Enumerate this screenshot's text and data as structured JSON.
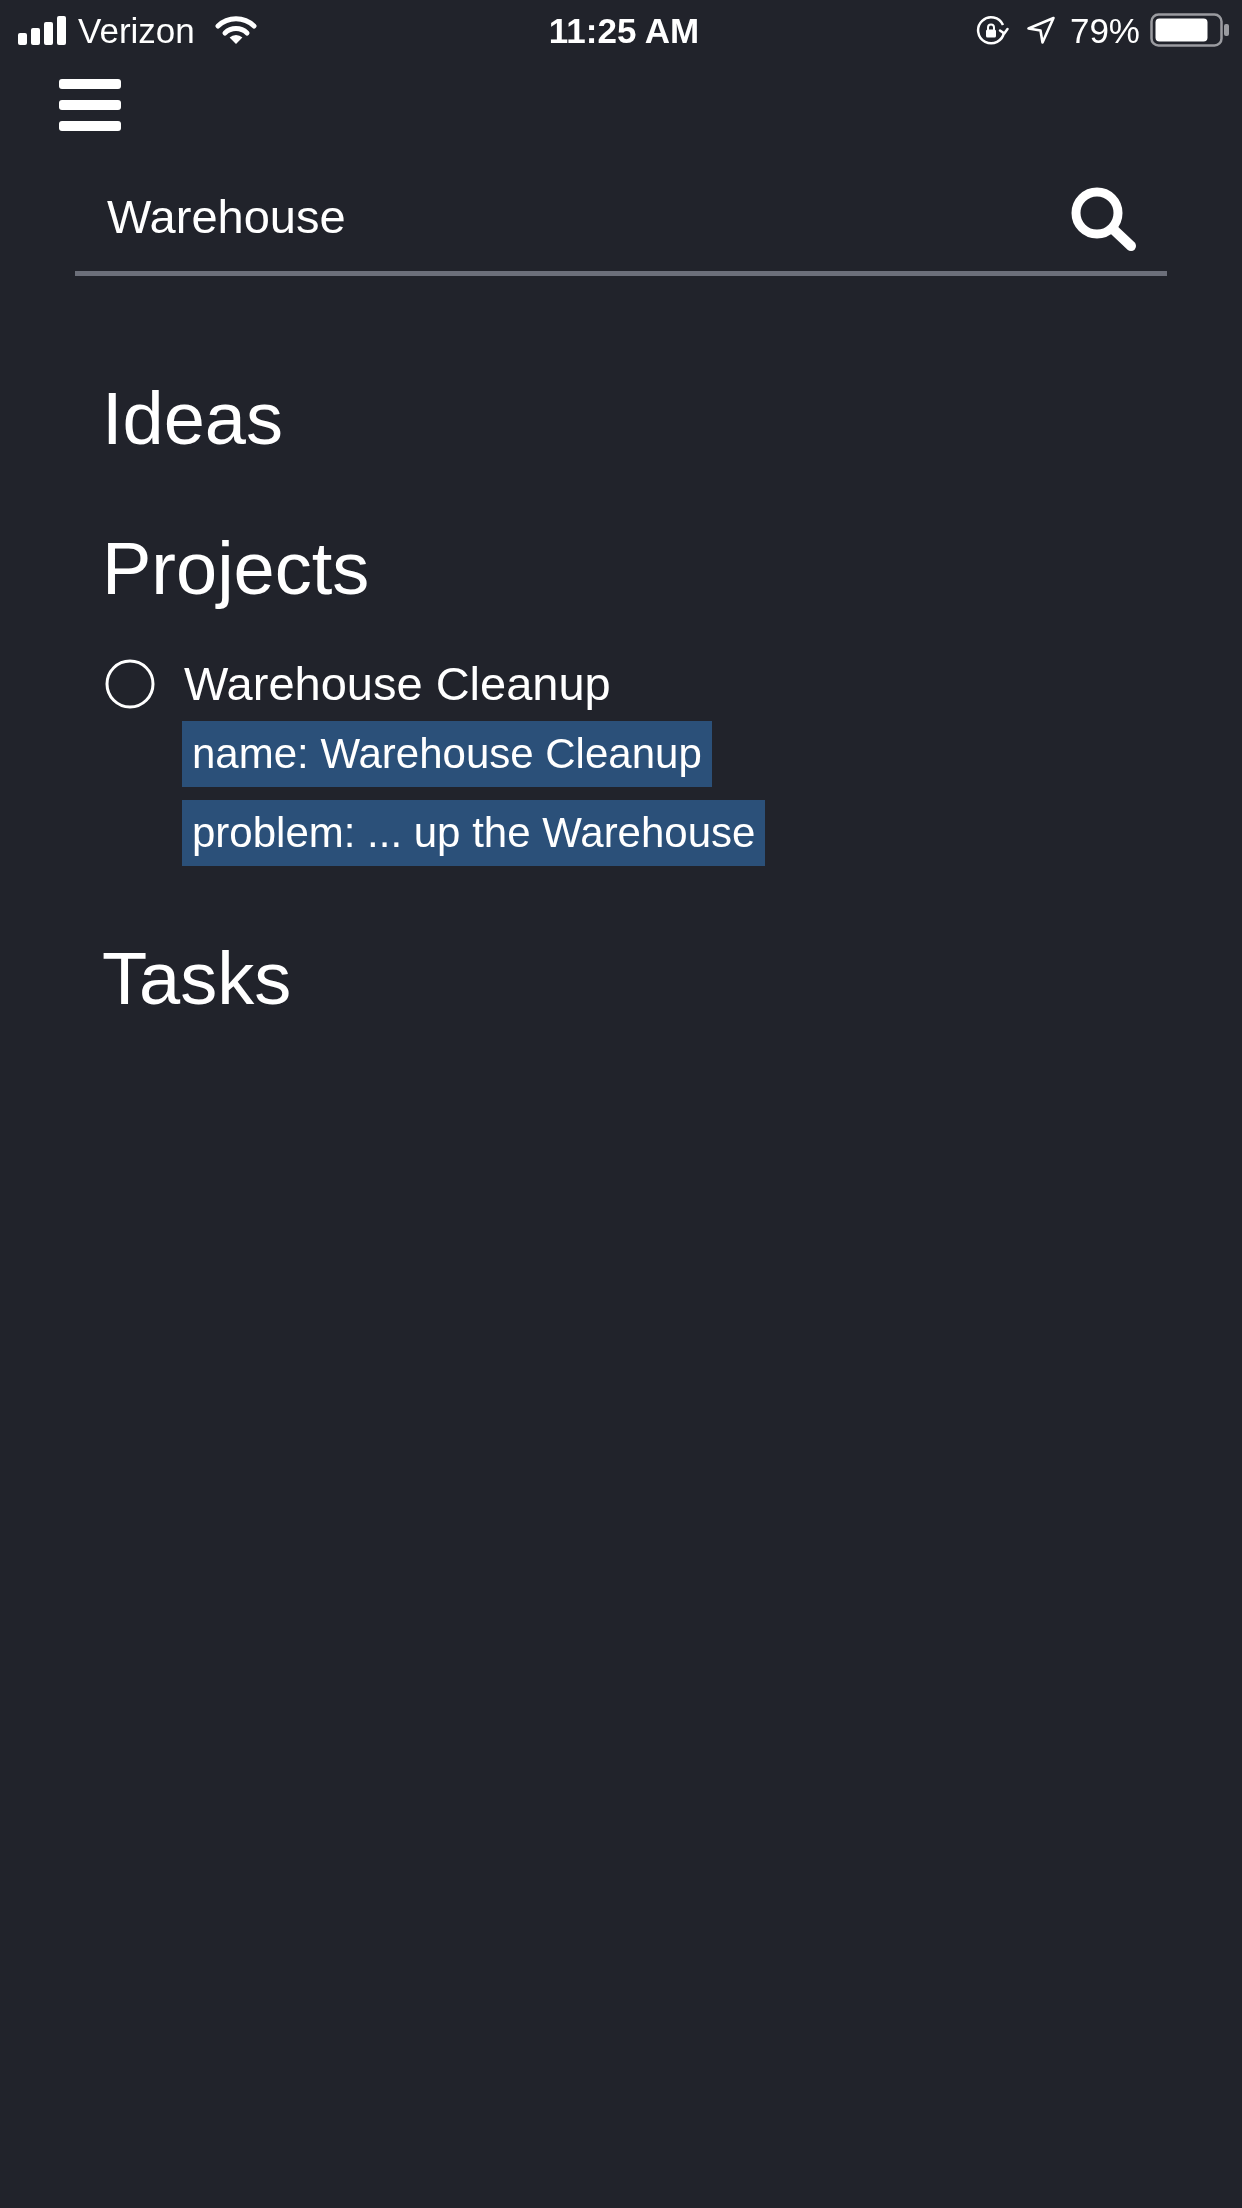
{
  "status_bar": {
    "carrier": "Verizon",
    "time": "11:25 AM",
    "battery": "79%"
  },
  "search": {
    "value": "Warehouse"
  },
  "sections": [
    {
      "title": "Ideas"
    },
    {
      "title": "Projects",
      "items": [
        {
          "title": "Warehouse Cleanup",
          "checked": false,
          "matches": [
            "name: Warehouse Cleanup",
            "problem: ... up the Warehouse"
          ]
        }
      ]
    },
    {
      "title": "Tasks"
    }
  ]
}
